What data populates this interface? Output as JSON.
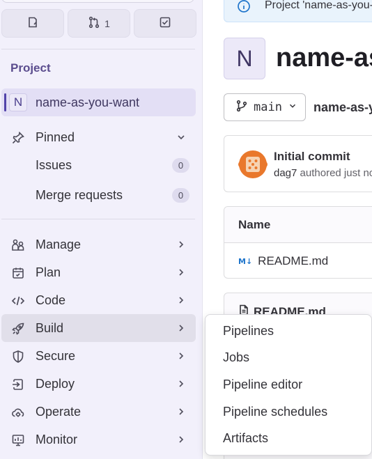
{
  "sidebar": {
    "top_buttons": [
      {
        "icon": "issues-icon",
        "label": ""
      },
      {
        "icon": "merge-request-icon",
        "label": "1"
      },
      {
        "icon": "todo-icon",
        "label": ""
      }
    ],
    "section_label": "Project",
    "project": {
      "avatar_letter": "N",
      "name": "name-as-you-want"
    },
    "pinned": {
      "label": "Pinned",
      "items": [
        {
          "label": "Issues",
          "count": "0"
        },
        {
          "label": "Merge requests",
          "count": "0"
        }
      ]
    },
    "nav": [
      {
        "label": "Manage",
        "icon": "users-icon"
      },
      {
        "label": "Plan",
        "icon": "calendar-icon"
      },
      {
        "label": "Code",
        "icon": "code-icon"
      },
      {
        "label": "Build",
        "icon": "rocket-icon"
      },
      {
        "label": "Secure",
        "icon": "shield-icon"
      },
      {
        "label": "Deploy",
        "icon": "deploy-icon"
      },
      {
        "label": "Operate",
        "icon": "cloud-gear-icon"
      },
      {
        "label": "Monitor",
        "icon": "monitor-icon"
      }
    ]
  },
  "main": {
    "alert_text": "Project 'name-as-you-want' was successfully created.",
    "project_avatar_letter": "N",
    "project_title": "name-as-you-want",
    "branch": "main",
    "breadcrumb_path": "name-as-you-want /",
    "commit": {
      "title": "Initial commit",
      "author": "dag7",
      "meta": "authored just now"
    },
    "files_header": "Name",
    "files": [
      {
        "icon": "markdown-icon",
        "icon_label": "M↓",
        "name": "README.md"
      }
    ],
    "readme_title": "README.md"
  },
  "build_menu": {
    "items": [
      "Pipelines",
      "Jobs",
      "Pipeline editor",
      "Pipeline schedules",
      "Artifacts"
    ]
  },
  "colors": {
    "sidebar_bg": "#f2f0fb",
    "active_project_bg": "#e3dff5",
    "accent": "#5243aa",
    "info_blue": "#1f75cb"
  }
}
